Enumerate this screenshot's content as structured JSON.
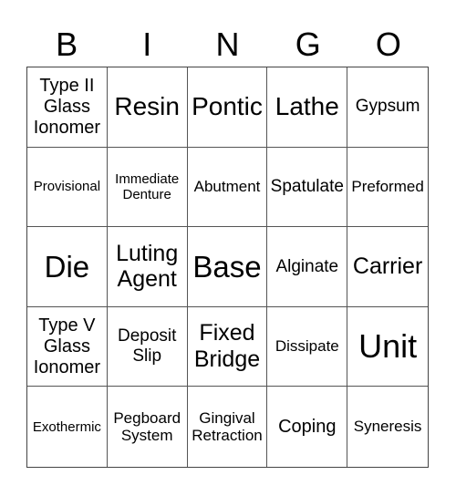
{
  "header": {
    "letters": [
      "B",
      "I",
      "N",
      "G",
      "O"
    ]
  },
  "board": {
    "cells": [
      {
        "text": "Type II Glass Ionomer",
        "size": "fs-ml"
      },
      {
        "text": "Resin",
        "size": "fs-xl"
      },
      {
        "text": "Pontic",
        "size": "fs-xl"
      },
      {
        "text": "Lathe",
        "size": "fs-xl"
      },
      {
        "text": "Gypsum",
        "size": "fs-m"
      },
      {
        "text": "Provisional",
        "size": "fs-xs"
      },
      {
        "text": "Immediate Denture",
        "size": "fs-xs"
      },
      {
        "text": "Abutment",
        "size": "fs-s"
      },
      {
        "text": "Spatulate",
        "size": "fs-m"
      },
      {
        "text": "Preformed",
        "size": "fs-s"
      },
      {
        "text": "Die",
        "size": "fs-xxl"
      },
      {
        "text": "Luting Agent",
        "size": "fs-l"
      },
      {
        "text": "Base",
        "size": "fs-xxl"
      },
      {
        "text": "Alginate",
        "size": "fs-m"
      },
      {
        "text": "Carrier",
        "size": "fs-l"
      },
      {
        "text": "Type V Glass Ionomer",
        "size": "fs-ml"
      },
      {
        "text": "Deposit Slip",
        "size": "fs-m"
      },
      {
        "text": "Fixed Bridge",
        "size": "fs-l"
      },
      {
        "text": "Dissipate",
        "size": "fs-s"
      },
      {
        "text": "Unit",
        "size": "fs-xxxl"
      },
      {
        "text": "Exothermic",
        "size": "fs-xs"
      },
      {
        "text": "Pegboard System",
        "size": "fs-s"
      },
      {
        "text": "Gingival Retraction",
        "size": "fs-s"
      },
      {
        "text": "Coping",
        "size": "fs-ml"
      },
      {
        "text": "Syneresis",
        "size": "fs-s"
      }
    ]
  }
}
